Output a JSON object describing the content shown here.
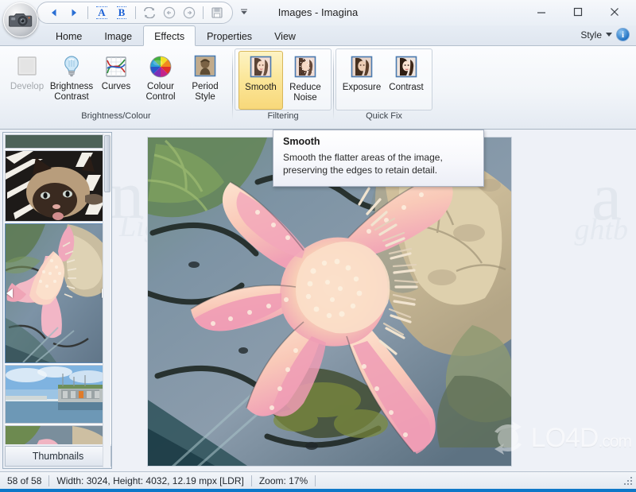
{
  "window": {
    "title": "Images - Imagina",
    "minimize_label": "Minimize",
    "maximize_label": "Maximize",
    "close_label": "Close",
    "accent_color": "#0d78c8"
  },
  "quick_access": {
    "items": [
      {
        "name": "previous",
        "label": "Previous",
        "glyph": "prev-triangle"
      },
      {
        "name": "next",
        "label": "Next",
        "glyph": "next-triangle"
      },
      {
        "name": "compare-a",
        "label": "A",
        "glyph": "a-chip"
      },
      {
        "name": "compare-b",
        "label": "B",
        "glyph": "b-chip"
      },
      {
        "name": "refresh",
        "label": "Refresh",
        "glyph": "refresh-arrows"
      },
      {
        "name": "back",
        "label": "Back",
        "glyph": "back-circle"
      },
      {
        "name": "forward",
        "label": "Forward",
        "glyph": "forward-circle"
      },
      {
        "name": "save",
        "label": "Save",
        "glyph": "floppy-disk"
      }
    ],
    "overflow_label": "Customize Quick Access Toolbar"
  },
  "ribbon": {
    "tabs": [
      {
        "label": "Home",
        "active": false
      },
      {
        "label": "Image",
        "active": false
      },
      {
        "label": "Effects",
        "active": true
      },
      {
        "label": "Properties",
        "active": false
      },
      {
        "label": "View",
        "active": false
      }
    ],
    "style_label": "Style",
    "info_label": "i",
    "groups": [
      {
        "name": "brightness-colour",
        "label": "Brightness/Colour",
        "boxed": false,
        "buttons": [
          {
            "label": "Develop",
            "icon": "blank-square-icon",
            "state": "disabled"
          },
          {
            "label": "Brightness\nContrast",
            "icon": "lightbulb-icon",
            "state": "normal"
          },
          {
            "label": "Curves",
            "icon": "curves-graph-icon",
            "state": "normal"
          },
          {
            "label": "Colour\nControl",
            "icon": "colour-wheel-icon",
            "state": "normal"
          },
          {
            "label": "Period\nStyle",
            "icon": "sepia-portrait-icon",
            "state": "normal"
          }
        ]
      },
      {
        "name": "filtering",
        "label": "Filtering",
        "boxed": true,
        "buttons": [
          {
            "label": "Smooth",
            "icon": "smooth-portrait-icon",
            "state": "selected"
          },
          {
            "label": "Reduce\nNoise",
            "icon": "noise-portrait-icon",
            "state": "normal"
          }
        ]
      },
      {
        "name": "quick-fix",
        "label": "Quick Fix",
        "boxed": true,
        "buttons": [
          {
            "label": "Exposure",
            "icon": "exposure-portrait-icon",
            "state": "normal"
          },
          {
            "label": "Contrast",
            "icon": "contrast-portrait-icon",
            "state": "normal"
          }
        ]
      }
    ]
  },
  "tooltip": {
    "title": "Smooth",
    "body": "Smooth the flatter areas of the image, preserving the edges to retain detail."
  },
  "thumbnails_panel": {
    "caption": "Thumbnails",
    "items": [
      {
        "name": "thumb-strip-top",
        "alt": "dark green strip",
        "selected": false
      },
      {
        "name": "thumb-cat",
        "alt": "Siamese cat lying on striped blanket",
        "selected": false
      },
      {
        "name": "thumb-starfish",
        "alt": "Pink starfish in rock pool",
        "selected": true
      },
      {
        "name": "thumb-waterfront",
        "alt": "Waterfront building under blue sky",
        "selected": false
      },
      {
        "name": "thumb-starfish-2",
        "alt": "Starfish rock pool partial",
        "selected": false
      }
    ],
    "prev_arrow": "left-triangle",
    "next_arrow": "right-triangle"
  },
  "viewer": {
    "image_alt": "Pink starfish in a shallow rock pool",
    "background_watermark_left": "n",
    "background_watermark_left_script": "Lig",
    "background_watermark_right": "a",
    "background_watermark_right_script": "ghtb"
  },
  "statusbar": {
    "cells": [
      "58 of 58",
      "Width: 3024, Height: 4032, 12.19 mpx [LDR]",
      "Zoom: 17%"
    ]
  },
  "overlay": {
    "site_name": "LO4D",
    "site_tld": ".com"
  }
}
